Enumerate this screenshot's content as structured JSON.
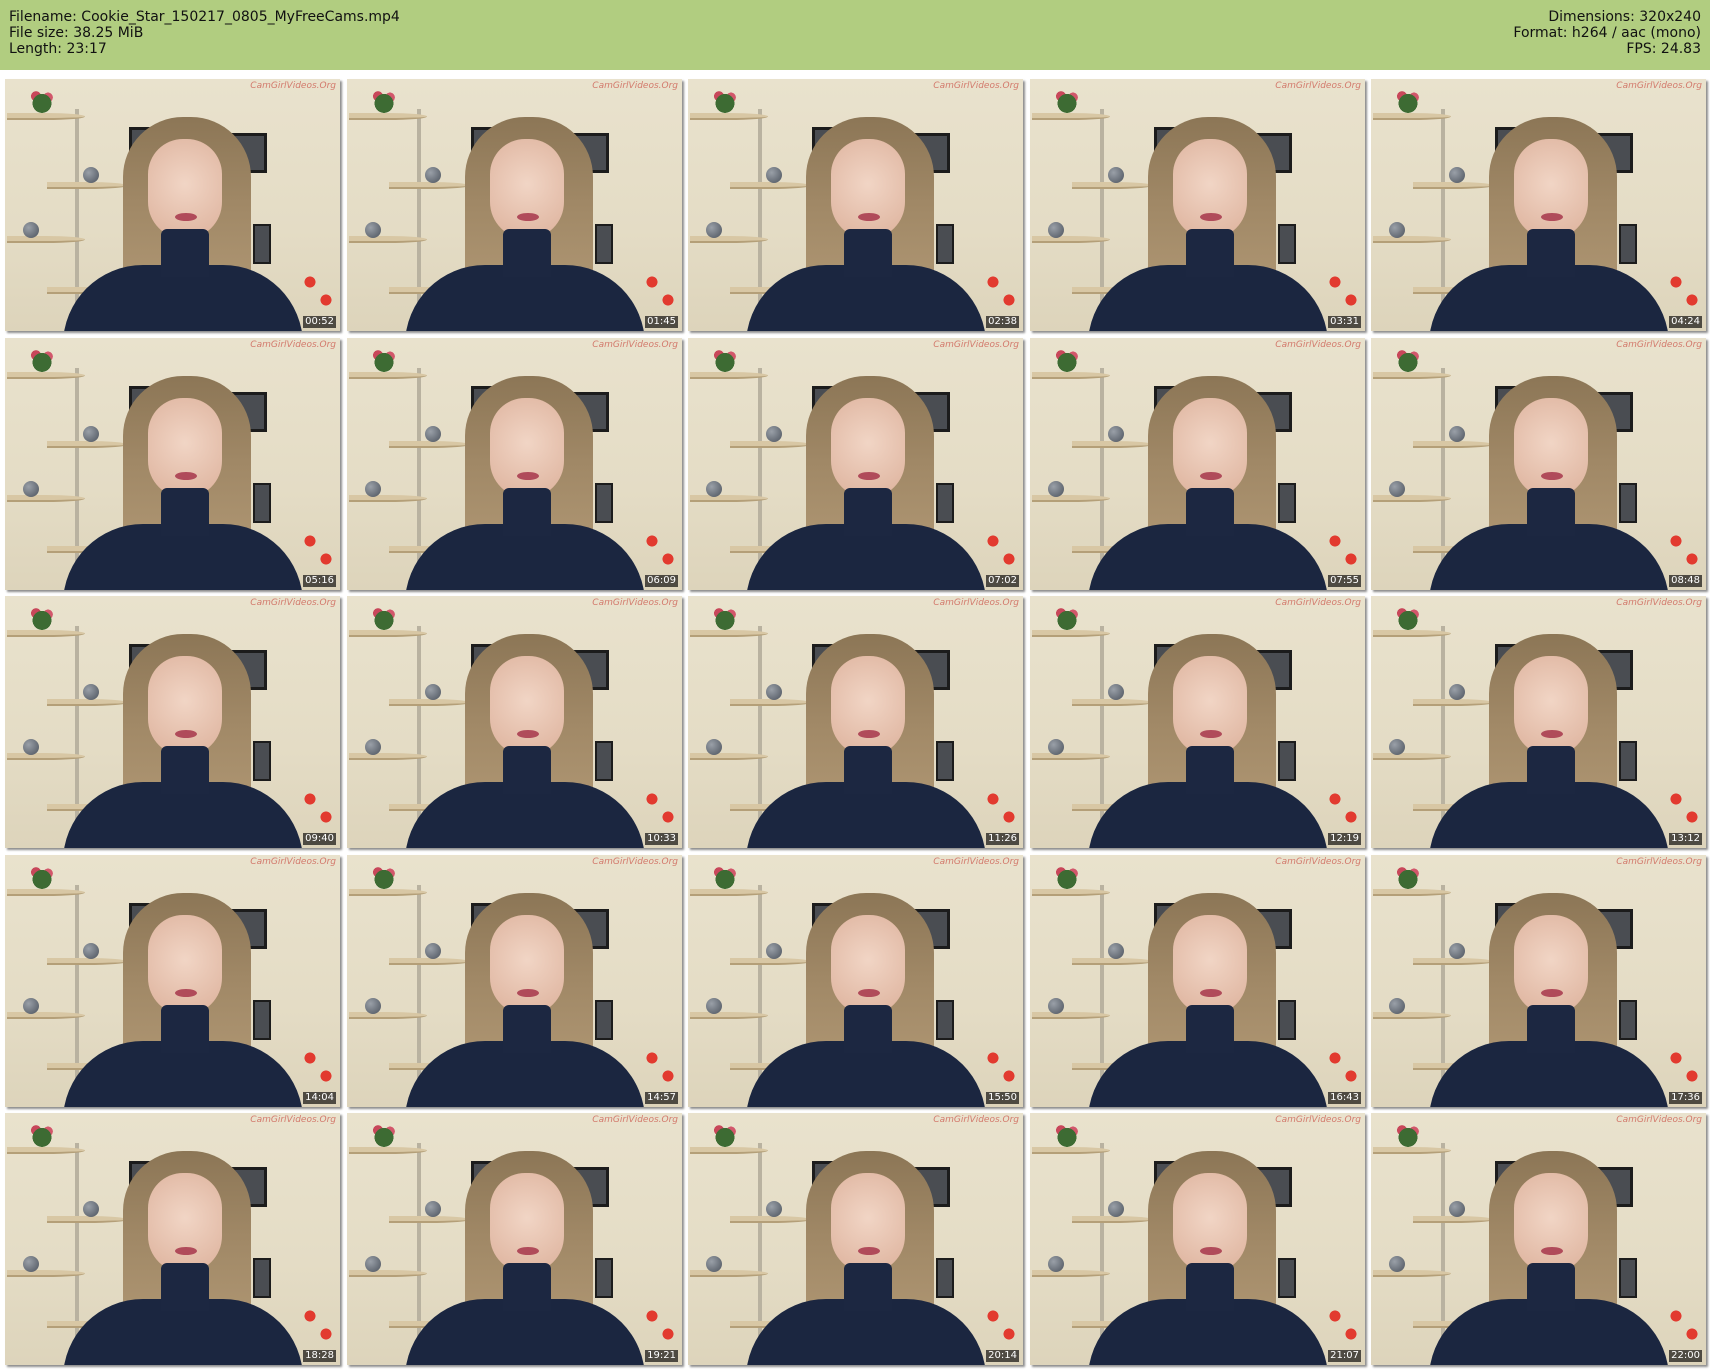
{
  "header": {
    "filename": "Filename: Cookie_Star_150217_0805_MyFreeCams.mp4",
    "filesize": "File size: 38.25 MiB",
    "length": "Length: 23:17",
    "dimensions": "Dimensions: 320x240",
    "format": "Format: h264 / aac (mono)",
    "fps": "FPS: 24.83",
    "background_color": "#b1cd80"
  },
  "thumbnails": [
    {
      "timestamp": "00:52"
    },
    {
      "timestamp": "01:45"
    },
    {
      "timestamp": "02:38"
    },
    {
      "timestamp": "03:31"
    },
    {
      "timestamp": "04:24"
    },
    {
      "timestamp": "05:16"
    },
    {
      "timestamp": "06:09"
    },
    {
      "timestamp": "07:02"
    },
    {
      "timestamp": "07:55"
    },
    {
      "timestamp": "08:48"
    },
    {
      "timestamp": "09:40"
    },
    {
      "timestamp": "10:33"
    },
    {
      "timestamp": "11:26"
    },
    {
      "timestamp": "12:19"
    },
    {
      "timestamp": "13:12"
    },
    {
      "timestamp": "14:04"
    },
    {
      "timestamp": "14:57"
    },
    {
      "timestamp": "15:50"
    },
    {
      "timestamp": "16:43"
    },
    {
      "timestamp": "17:36"
    },
    {
      "timestamp": "18:28"
    },
    {
      "timestamp": "19:21"
    },
    {
      "timestamp": "20:14"
    },
    {
      "timestamp": "21:07"
    },
    {
      "timestamp": "22:00"
    }
  ],
  "watermark": "CamGirlVideos.Org"
}
